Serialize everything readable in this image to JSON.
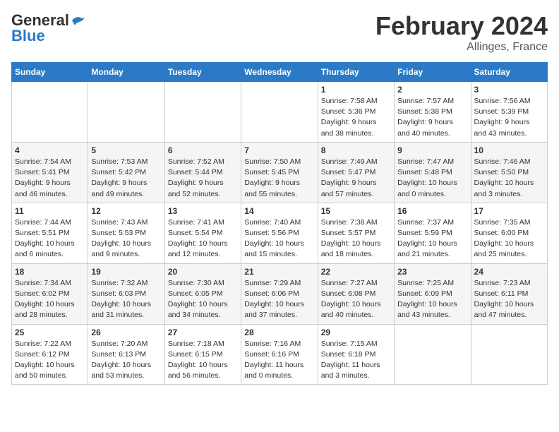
{
  "header": {
    "logo_line1": "General",
    "logo_line2": "Blue",
    "title": "February 2024",
    "subtitle": "Allinges, France"
  },
  "columns": [
    "Sunday",
    "Monday",
    "Tuesday",
    "Wednesday",
    "Thursday",
    "Friday",
    "Saturday"
  ],
  "weeks": [
    [
      {
        "day": "",
        "info": ""
      },
      {
        "day": "",
        "info": ""
      },
      {
        "day": "",
        "info": ""
      },
      {
        "day": "",
        "info": ""
      },
      {
        "day": "1",
        "info": "Sunrise: 7:58 AM\nSunset: 5:36 PM\nDaylight: 9 hours\nand 38 minutes."
      },
      {
        "day": "2",
        "info": "Sunrise: 7:57 AM\nSunset: 5:38 PM\nDaylight: 9 hours\nand 40 minutes."
      },
      {
        "day": "3",
        "info": "Sunrise: 7:56 AM\nSunset: 5:39 PM\nDaylight: 9 hours\nand 43 minutes."
      }
    ],
    [
      {
        "day": "4",
        "info": "Sunrise: 7:54 AM\nSunset: 5:41 PM\nDaylight: 9 hours\nand 46 minutes."
      },
      {
        "day": "5",
        "info": "Sunrise: 7:53 AM\nSunset: 5:42 PM\nDaylight: 9 hours\nand 49 minutes."
      },
      {
        "day": "6",
        "info": "Sunrise: 7:52 AM\nSunset: 5:44 PM\nDaylight: 9 hours\nand 52 minutes."
      },
      {
        "day": "7",
        "info": "Sunrise: 7:50 AM\nSunset: 5:45 PM\nDaylight: 9 hours\nand 55 minutes."
      },
      {
        "day": "8",
        "info": "Sunrise: 7:49 AM\nSunset: 5:47 PM\nDaylight: 9 hours\nand 57 minutes."
      },
      {
        "day": "9",
        "info": "Sunrise: 7:47 AM\nSunset: 5:48 PM\nDaylight: 10 hours\nand 0 minutes."
      },
      {
        "day": "10",
        "info": "Sunrise: 7:46 AM\nSunset: 5:50 PM\nDaylight: 10 hours\nand 3 minutes."
      }
    ],
    [
      {
        "day": "11",
        "info": "Sunrise: 7:44 AM\nSunset: 5:51 PM\nDaylight: 10 hours\nand 6 minutes."
      },
      {
        "day": "12",
        "info": "Sunrise: 7:43 AM\nSunset: 5:53 PM\nDaylight: 10 hours\nand 9 minutes."
      },
      {
        "day": "13",
        "info": "Sunrise: 7:41 AM\nSunset: 5:54 PM\nDaylight: 10 hours\nand 12 minutes."
      },
      {
        "day": "14",
        "info": "Sunrise: 7:40 AM\nSunset: 5:56 PM\nDaylight: 10 hours\nand 15 minutes."
      },
      {
        "day": "15",
        "info": "Sunrise: 7:38 AM\nSunset: 5:57 PM\nDaylight: 10 hours\nand 18 minutes."
      },
      {
        "day": "16",
        "info": "Sunrise: 7:37 AM\nSunset: 5:59 PM\nDaylight: 10 hours\nand 21 minutes."
      },
      {
        "day": "17",
        "info": "Sunrise: 7:35 AM\nSunset: 6:00 PM\nDaylight: 10 hours\nand 25 minutes."
      }
    ],
    [
      {
        "day": "18",
        "info": "Sunrise: 7:34 AM\nSunset: 6:02 PM\nDaylight: 10 hours\nand 28 minutes."
      },
      {
        "day": "19",
        "info": "Sunrise: 7:32 AM\nSunset: 6:03 PM\nDaylight: 10 hours\nand 31 minutes."
      },
      {
        "day": "20",
        "info": "Sunrise: 7:30 AM\nSunset: 6:05 PM\nDaylight: 10 hours\nand 34 minutes."
      },
      {
        "day": "21",
        "info": "Sunrise: 7:29 AM\nSunset: 6:06 PM\nDaylight: 10 hours\nand 37 minutes."
      },
      {
        "day": "22",
        "info": "Sunrise: 7:27 AM\nSunset: 6:08 PM\nDaylight: 10 hours\nand 40 minutes."
      },
      {
        "day": "23",
        "info": "Sunrise: 7:25 AM\nSunset: 6:09 PM\nDaylight: 10 hours\nand 43 minutes."
      },
      {
        "day": "24",
        "info": "Sunrise: 7:23 AM\nSunset: 6:11 PM\nDaylight: 10 hours\nand 47 minutes."
      }
    ],
    [
      {
        "day": "25",
        "info": "Sunrise: 7:22 AM\nSunset: 6:12 PM\nDaylight: 10 hours\nand 50 minutes."
      },
      {
        "day": "26",
        "info": "Sunrise: 7:20 AM\nSunset: 6:13 PM\nDaylight: 10 hours\nand 53 minutes."
      },
      {
        "day": "27",
        "info": "Sunrise: 7:18 AM\nSunset: 6:15 PM\nDaylight: 10 hours\nand 56 minutes."
      },
      {
        "day": "28",
        "info": "Sunrise: 7:16 AM\nSunset: 6:16 PM\nDaylight: 11 hours\nand 0 minutes."
      },
      {
        "day": "29",
        "info": "Sunrise: 7:15 AM\nSunset: 6:18 PM\nDaylight: 11 hours\nand 3 minutes."
      },
      {
        "day": "",
        "info": ""
      },
      {
        "day": "",
        "info": ""
      }
    ]
  ]
}
